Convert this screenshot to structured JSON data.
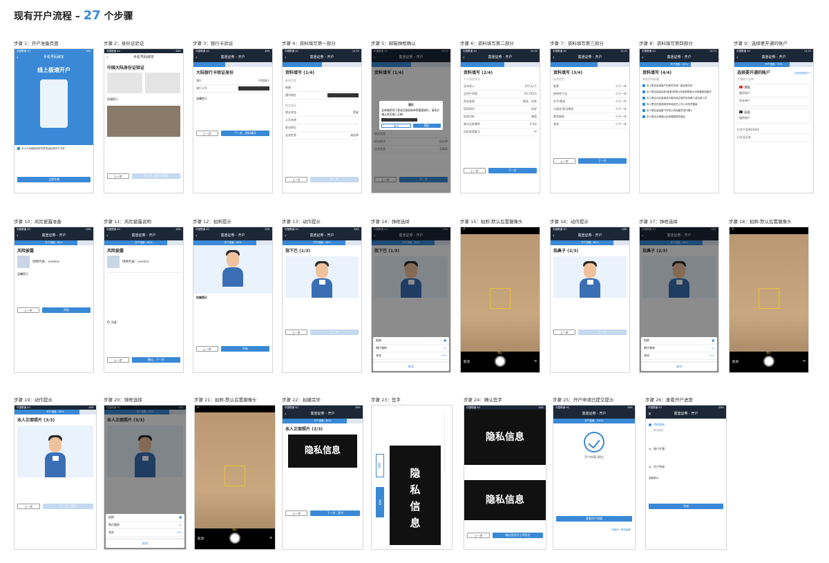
{
  "page": {
    "title_prefix": "现有开户流程 – ",
    "count": "27",
    "title_suffix": " 个步骤"
  },
  "common": {
    "nav_title": "富途证券 - 开户",
    "prev": "上一步",
    "next": "下一步",
    "cancel": "取消",
    "shoot": "拍照",
    "gallery": "照片图库",
    "browse": "浏览",
    "photo": "照片",
    "privacy": "隐私信息",
    "progress_80": "开户进度：80%",
    "progress_65": "开户进度：65%",
    "progress_70": "开户进度：70%",
    "progress_100": "开户进度：100%",
    "status_carrier": "中国联通 4G",
    "status_time": "14:33",
    "status_batt": "48%"
  },
  "steps": [
    {
      "label": "步骤 1：开户准备页面"
    },
    {
      "label": "步骤 2：身份证验证"
    },
    {
      "label": "步骤 3：银行卡验证"
    },
    {
      "label": "步骤 4：资料填写第一部分"
    },
    {
      "label": "步骤 5：邮箱弹框确认"
    },
    {
      "label": "步骤 6：资料填写第二部分"
    },
    {
      "label": "步骤 7：资料填写第三部分"
    },
    {
      "label": "步骤 8：资料填写第四部分"
    },
    {
      "label": "步骤 9：选择要开通的账户"
    },
    {
      "label": "步骤 10：风险披露准备"
    },
    {
      "label": "步骤 11：风险披露说明"
    },
    {
      "label": "步骤 12：拍照提示"
    },
    {
      "label": "步骤 13：动作提示"
    },
    {
      "label": "步骤 14：弹框选择"
    },
    {
      "label": "步骤 15：拍照-默认后置摄像头"
    },
    {
      "label": "步骤 16：动作提示"
    },
    {
      "label": "步骤 17：弹框选择"
    },
    {
      "label": "步骤 18：拍照-默认后置摄像头"
    },
    {
      "label": "步骤 19：动作提示"
    },
    {
      "label": "步骤 20：弹框选择"
    },
    {
      "label": "步骤 21：拍照-默认后置摄像头"
    },
    {
      "label": "步骤 22：拍摄完毕"
    },
    {
      "label": "步骤 23：签字"
    },
    {
      "label": "步骤 24：确认签字"
    },
    {
      "label": "步骤 25：开户申请已提交提示"
    },
    {
      "label": "步骤 26：查看开户进度"
    }
  ],
  "s1": {
    "nav": "手机号码绑定",
    "hero": "线上极速开户",
    "agree": "本人已详细阅读并同意富途证券开户文件",
    "btn": "立即开通"
  },
  "s2": {
    "nav": "手机号码绑定",
    "title": "中国大陆身份证验证",
    "tips": "拍摄提示",
    "next": "下一步，银行卡验证"
  },
  "s3": {
    "title": "大陆银行卡验证身份",
    "bank": "银行",
    "bank_val": "中国银行",
    "card": "银行卡号",
    "tips": "温馨提示",
    "next": "下一步，资料填写"
  },
  "s4": {
    "title": "资料填写",
    "page": "(1/4)",
    "f1": "联系信息",
    "f2": "邮箱",
    "f3": "通讯地址",
    "f4": "职业状况",
    "f5": "就业状态",
    "f5v": "受雇",
    "f6": "公司名称",
    "f7": "职业职位",
    "f8": "业务性质",
    "f8v": "请选择"
  },
  "s5": {
    "title": "提示",
    "body": "此邮箱将用于登录及接收账单等重要操作，请再次确认是否输入正确：",
    "ok": "确定",
    "cancel": "取消",
    "f1": "就业状态",
    "f2": "职业职位",
    "f2v": "设计师",
    "f3": "业务性质",
    "f3v": "互联网"
  },
  "s6": {
    "title": "资料填写",
    "page": "(2/4)",
    "sub": "个人财务状况",
    "rows": [
      [
        "全年收入",
        "20万以下"
      ],
      [
        "总资产净值",
        "50-250万"
      ],
      [
        "资金来源",
        "薪金、存款"
      ],
      [
        "投资知识",
        "良好"
      ],
      [
        "投资目的",
        "增值"
      ],
      [
        "每月交易频率",
        "0-5次"
      ],
      [
        "风险承受能力",
        "中"
      ]
    ]
  },
  "s7": {
    "title": "资料填写",
    "page": "(3/4)",
    "sub": "投资经验",
    "rows": [
      [
        "股票",
        "少于一年"
      ],
      [
        "结构性产品",
        "少于一年"
      ],
      [
        "外币/黄金",
        "少于一年"
      ],
      [
        "认股证/权证期权",
        "少于一年"
      ],
      [
        "期货期权",
        "少于一年"
      ],
      [
        "其他",
        "少于一年"
      ]
    ]
  },
  "s8": {
    "title": "资料填写",
    "page": "(4/4)",
    "sub": "其他资料披露",
    "items": [
      "本人是否富途客户的操作员或一级亲属关系",
      "本人是否富途证券(香港)有限公司或其联营公司的董事或雇员",
      "本人是否为在香港或中国内地交易所的持牌人或注册人员",
      "本人是否在香港或其他地区的上市公司担任董事",
      "本人是否富途旗下任何公司的雇员或代理人",
      "本人是否为美国公民或美国税务居民"
    ]
  },
  "s9": {
    "title": "选择要开通的账户",
    "link": "如何选择账户?",
    "sub": "开通账户选择",
    "hk": "港股",
    "us": "美股",
    "o1": "融资账户",
    "o2": "现金账户",
    "o3": "融资账户",
    "risk": "衍生产品知识评估",
    "risk2": "衍生品买卖"
  },
  "s10": {
    "title": "风险披露",
    "rep": "持牌代表：eveline",
    "tips": "温馨提示",
    "start": "开始"
  },
  "s11": {
    "title": "风险披露",
    "rep": "持牌代表：eveline",
    "agree": "同意",
    "next": "确认，下一步"
  },
  "s12": {
    "tips": "拍摄提示",
    "start": "开始"
  },
  "s13": {
    "title": "指下巴 (1/3)"
  },
  "s14": {
    "title": "指下巴 (1/3)"
  },
  "s16": {
    "title": "指鼻子 (2/3)"
  },
  "s17": {
    "title": "指鼻子 (2/3)"
  },
  "s19": {
    "title": "本人正面照片 (3/3)",
    "next": "下一步，签字"
  },
  "s20": {
    "title": "本人正面照片 (3/3)"
  },
  "s22": {
    "title": "本人正面照片 (3/3)",
    "next": "下一步，签字"
  },
  "s23": {
    "clear": "清除",
    "done": "完成",
    "chars": [
      "隐",
      "私",
      "信",
      "息"
    ]
  },
  "s24": {
    "confirm": "确认签名并上传签名"
  },
  "s25": {
    "msg": "开户申请已提交",
    "btn": "查看开户进度",
    "help": "有疑问？联系客服"
  },
  "s26": {
    "t1": "资料审核",
    "t1s": "等待审核",
    "t2": "账户开通",
    "t3": "开户完成",
    "btn": "完成",
    "tips": "温馨提示"
  },
  "colors": {
    "accent": "#3a89d6",
    "nav": "#1c2737"
  }
}
